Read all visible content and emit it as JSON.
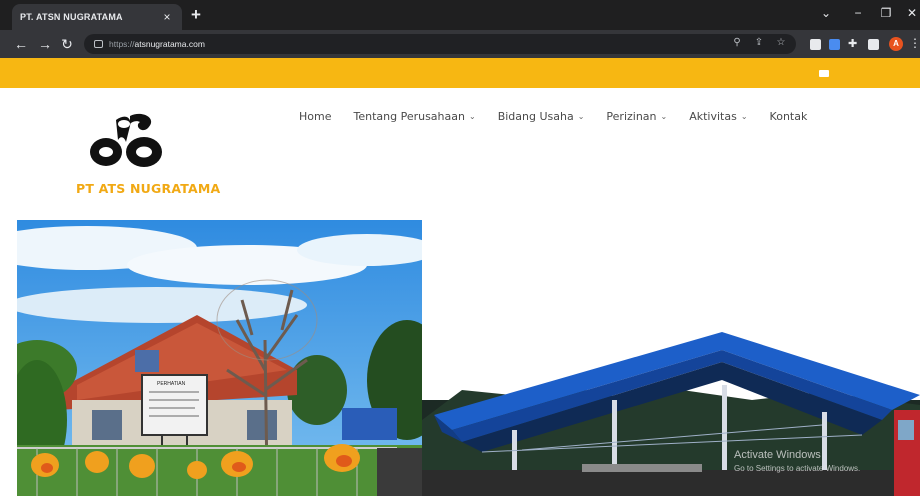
{
  "browser": {
    "tab_title": "PT. ATSN NUGRATAMA",
    "tab_close": "×",
    "new_tab": "+",
    "url_protocol": "https://",
    "url_host": "atsnugratama.com",
    "profile_initial": "A"
  },
  "site": {
    "brand": "PT ATS NUGRATAMA",
    "brand_color": "#f1a914",
    "topbar_color": "#f7b712",
    "nav": [
      {
        "label": "Home",
        "dropdown": false
      },
      {
        "label": "Tentang Perusahaan",
        "dropdown": true
      },
      {
        "label": "Bidang Usaha",
        "dropdown": true
      },
      {
        "label": "Perizinan",
        "dropdown": true
      },
      {
        "label": "Aktivitas",
        "dropdown": true
      },
      {
        "label": "Kontak",
        "dropdown": false
      }
    ],
    "sign_text": "PERHATIAN"
  },
  "watermark": {
    "line1": "Activate Windows",
    "line2": "Go to Settings to activate Windows."
  }
}
